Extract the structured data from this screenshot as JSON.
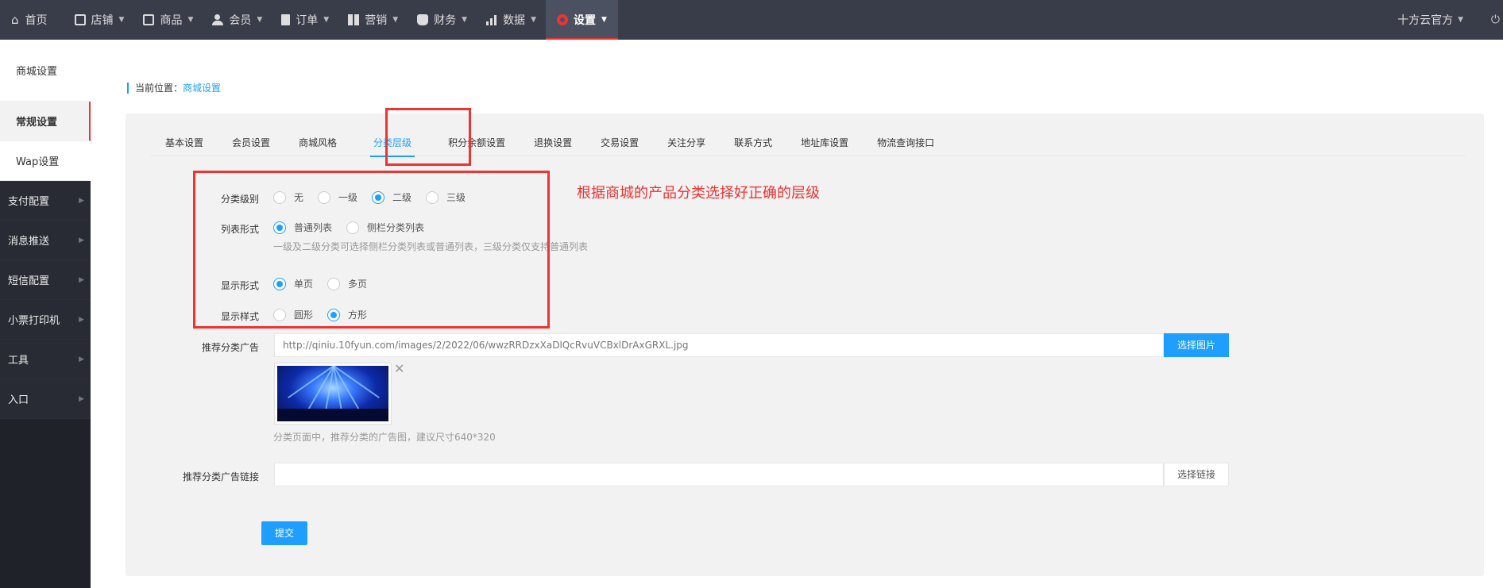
{
  "topnav": {
    "home": "首页",
    "items": [
      {
        "label": "店铺",
        "icon": "store-icon"
      },
      {
        "label": "商品",
        "icon": "goods-icon"
      },
      {
        "label": "会员",
        "icon": "user-icon"
      },
      {
        "label": "订单",
        "icon": "order-icon"
      },
      {
        "label": "营销",
        "icon": "gift-icon"
      },
      {
        "label": "财务",
        "icon": "money-bag-icon"
      },
      {
        "label": "数据",
        "icon": "chart-icon"
      },
      {
        "label": "设置",
        "icon": "gear-icon",
        "active": true
      }
    ],
    "account": "十方云官方"
  },
  "sidebar": {
    "items": [
      {
        "label": "商城设置"
      },
      {
        "label": "常规设置",
        "active": true
      },
      {
        "label": "Wap设置"
      },
      {
        "label": "支付配置"
      },
      {
        "label": "消息推送"
      },
      {
        "label": "短信配置"
      },
      {
        "label": "小票打印机"
      },
      {
        "label": "工具"
      },
      {
        "label": "入口"
      }
    ]
  },
  "breadcrumb": {
    "prefix": "当前位置：",
    "current": "商城设置"
  },
  "tabs": [
    "基本设置",
    "会员设置",
    "商城风格",
    "分类层级",
    "积分余额设置",
    "退换设置",
    "交易设置",
    "关注分享",
    "联系方式",
    "地址库设置",
    "物流查询接口"
  ],
  "form": {
    "level": {
      "label": "分类级别",
      "options": [
        "无",
        "一级",
        "二级",
        "三级"
      ],
      "selected": "二级"
    },
    "list_style": {
      "label": "列表形式",
      "options": [
        "普通列表",
        "侧栏分类列表"
      ],
      "selected": "普通列表",
      "hint": "一级及二级分类可选择侧栏分类列表或普通列表，三级分类仅支持普通列表"
    },
    "display_mode": {
      "label": "显示形式",
      "options": [
        "单页",
        "多页"
      ],
      "selected": "单页"
    },
    "display_style": {
      "label": "显示样式",
      "options": [
        "圆形",
        "方形"
      ],
      "selected": "方形"
    },
    "ad": {
      "label": "推荐分类广告",
      "value": "http://qiniu.10fyun.com/images/2/2022/06/wwzRRDzxXaDlQcRvuVCBxlDrAxGRXL.jpg",
      "button": "选择图片",
      "hint": "分类页面中，推荐分类的广告图，建议尺寸640*320"
    },
    "ad_link": {
      "label": "推荐分类广告链接",
      "value": "",
      "button": "选择链接"
    },
    "submit": "提交"
  },
  "annotation": "根据商城的产品分类选择好正确的层级",
  "colors": {
    "accent": "#1e9fff",
    "highlight": "#e33333",
    "topbar": "#393d49",
    "sidebar": "#20222a"
  }
}
